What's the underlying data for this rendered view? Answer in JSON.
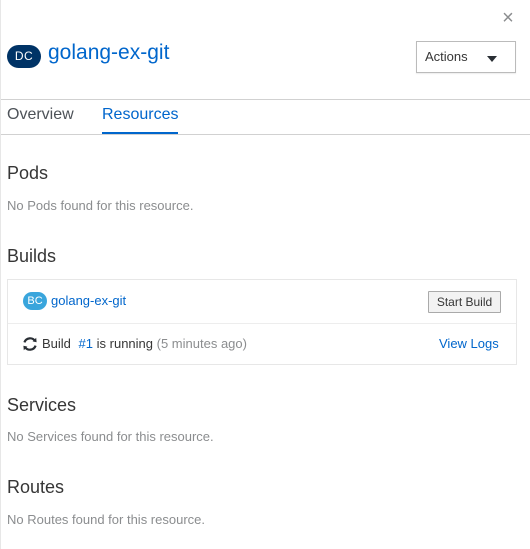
{
  "header": {
    "close_icon_glyph": "×",
    "kind_badge": "DC",
    "title": "golang-ex-git",
    "actions_label": "Actions"
  },
  "tabs": [
    {
      "label": "Overview",
      "active": false
    },
    {
      "label": "Resources",
      "active": true
    }
  ],
  "pods": {
    "title": "Pods",
    "empty_text": "No Pods found for this resource."
  },
  "builds": {
    "title": "Builds",
    "config_badge": "BC",
    "config_name": "golang-ex-git",
    "start_build_label": "Start Build",
    "status": {
      "prefix": "Build",
      "number": "#1",
      "state": "is running",
      "time": "(5 minutes ago)",
      "view_logs_label": "View Logs"
    }
  },
  "services": {
    "title": "Services",
    "empty_text": "No Services found for this resource."
  },
  "routes": {
    "title": "Routes",
    "empty_text": "No Routes found for this resource."
  },
  "colors": {
    "link": "#0066cc",
    "dc_badge": "#003366",
    "bc_badge": "#39a5dc",
    "muted_text": "#8b8d8f"
  }
}
